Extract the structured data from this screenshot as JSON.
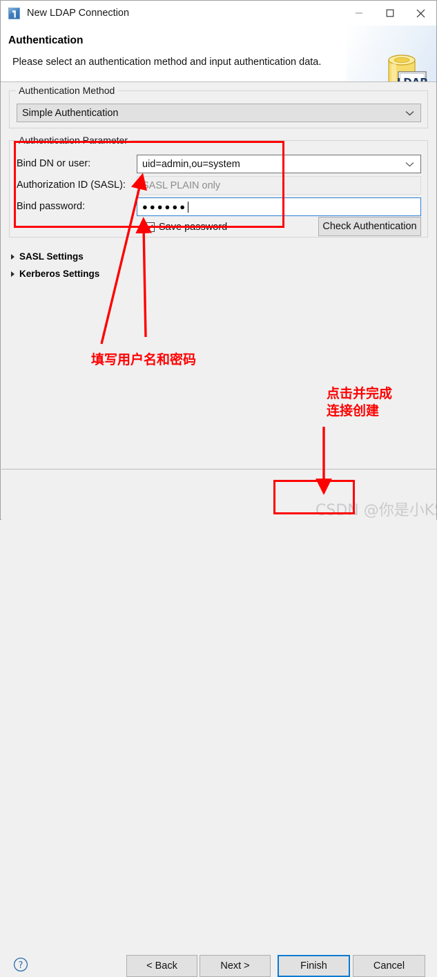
{
  "window": {
    "title": "New LDAP Connection",
    "app_icon": "ldap-app-icon",
    "controls": {
      "minimize": "minimize-icon",
      "maximize": "maximize-icon",
      "close": "close-icon"
    }
  },
  "header": {
    "title": "Authentication",
    "description": "Please select an authentication method and input authentication data.",
    "badge_label": "LDAP"
  },
  "auth_method": {
    "group_label": "Authentication Method",
    "selected": "Simple Authentication",
    "options": [
      "Simple Authentication"
    ]
  },
  "auth_parameter": {
    "group_label": "Authentication Parameter",
    "bind_dn": {
      "label": "Bind DN or user:",
      "value": "uid=admin,ou=system"
    },
    "authz_id": {
      "label": "Authorization ID (SASL):",
      "placeholder": "SASL PLAIN only",
      "value": ""
    },
    "bind_password": {
      "label": "Bind password:",
      "masked_value": "●●●●●●",
      "character_count": "6"
    },
    "save_password": {
      "label": "Save password",
      "checked": "true"
    },
    "check_button": "Check Authentication"
  },
  "sections": [
    {
      "label": "SASL Settings",
      "expanded": "false"
    },
    {
      "label": "Kerberos Settings",
      "expanded": "false"
    }
  ],
  "footer": {
    "help": "help-icon",
    "buttons": {
      "back": "< Back",
      "next": "Next >",
      "finish": "Finish",
      "cancel": "Cancel"
    }
  },
  "annotations": {
    "accent_color": "#fe0000",
    "note_fields": "填写用户名和密码",
    "note_finish": "点击并完成\n连接创建"
  },
  "watermark": "CSDN @你是小KS"
}
